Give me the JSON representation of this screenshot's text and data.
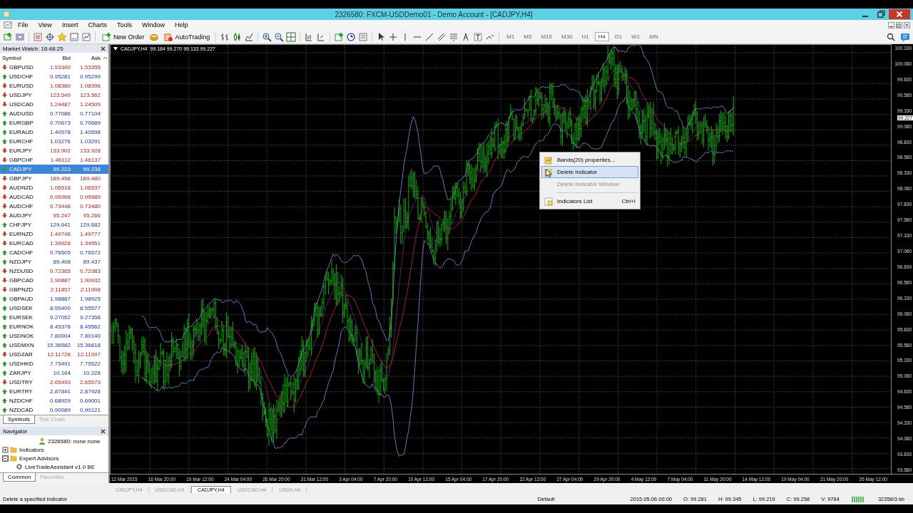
{
  "window": {
    "title": "2326580: FXCM-USDDemo01 - Demo Account - [CADJPY,H4]"
  },
  "menu": [
    "File",
    "View",
    "Insert",
    "Charts",
    "Tools",
    "Window",
    "Help"
  ],
  "toolbar": {
    "buttons": [
      {
        "label": "New Order"
      },
      {
        "label": "AutoTrading"
      }
    ],
    "timeframes": [
      {
        "label": "M1",
        "selected": false
      },
      {
        "label": "M5",
        "selected": false
      },
      {
        "label": "M15",
        "selected": false
      },
      {
        "label": "M30",
        "selected": false
      },
      {
        "label": "H1",
        "selected": false
      },
      {
        "label": "H4",
        "selected": true
      },
      {
        "label": "D1",
        "selected": false
      },
      {
        "label": "W1",
        "selected": false
      },
      {
        "label": "MN",
        "selected": false
      }
    ]
  },
  "market_watch": {
    "title": "Market Watch: 16:48:25",
    "columns": [
      "Symbol",
      "Bid",
      "Ask"
    ],
    "rows": [
      {
        "symbol": "GBPUSD",
        "bid": "1.53340",
        "ask": "1.53355",
        "kind": "down",
        "selected": false
      },
      {
        "symbol": "USDCHF",
        "bid": "0.95281",
        "ask": "0.95299",
        "kind": "up",
        "selected": false
      },
      {
        "symbol": "EURUSD",
        "bid": "1.08380",
        "ask": "1.08396",
        "kind": "down",
        "selected": false
      },
      {
        "symbol": "USDJPY",
        "bid": "123.549",
        "ask": "123.562",
        "kind": "down",
        "selected": false
      },
      {
        "symbol": "USDCAD",
        "bid": "1.24487",
        "ask": "1.24509",
        "kind": "down",
        "selected": false
      },
      {
        "symbol": "AUDUSD",
        "bid": "0.77086",
        "ask": "0.77104",
        "kind": "up",
        "selected": false
      },
      {
        "symbol": "EURGBP",
        "bid": "0.70673",
        "ask": "0.70689",
        "kind": "up",
        "selected": false
      },
      {
        "symbol": "EURAUD",
        "bid": "1.40578",
        "ask": "1.40598",
        "kind": "up",
        "selected": false
      },
      {
        "symbol": "EURCHF",
        "bid": "1.03276",
        "ask": "1.03291",
        "kind": "up",
        "selected": false
      },
      {
        "symbol": "EURJPY",
        "bid": "133.902",
        "ask": "133.928",
        "kind": "down",
        "selected": false
      },
      {
        "symbol": "GBPCHF",
        "bid": "1.46112",
        "ask": "1.46137",
        "kind": "down",
        "selected": false
      },
      {
        "symbol": "CADJPY",
        "bid": "99.223",
        "ask": "99.238",
        "kind": "up",
        "selected": true
      },
      {
        "symbol": "GBPJPY",
        "bid": "189.456",
        "ask": "189.480",
        "kind": "down",
        "selected": false
      },
      {
        "symbol": "AUDNZD",
        "bid": "1.06518",
        "ask": "1.06537",
        "kind": "down",
        "selected": false
      },
      {
        "symbol": "AUDCAD",
        "bid": "0.95968",
        "ask": "0.95989",
        "kind": "down",
        "selected": false
      },
      {
        "symbol": "AUDCHF",
        "bid": "0.73448",
        "ask": "0.73480",
        "kind": "down",
        "selected": false
      },
      {
        "symbol": "AUDJPY",
        "bid": "95.247",
        "ask": "95.266",
        "kind": "down",
        "selected": false
      },
      {
        "symbol": "CHFJPY",
        "bid": "129.641",
        "ask": "129.682",
        "kind": "up",
        "selected": false
      },
      {
        "symbol": "EURNZD",
        "bid": "1.49746",
        "ask": "1.49777",
        "kind": "down",
        "selected": false
      },
      {
        "symbol": "EURCAD",
        "bid": "1.34928",
        "ask": "1.34951",
        "kind": "down",
        "selected": false
      },
      {
        "symbol": "CADCHF",
        "bid": "0.76505",
        "ask": "0.76572",
        "kind": "up",
        "selected": false
      },
      {
        "symbol": "NZDJPY",
        "bid": "89.408",
        "ask": "89.437",
        "kind": "up",
        "selected": false
      },
      {
        "symbol": "NZDUSD",
        "bid": "0.72365",
        "ask": "0.72383",
        "kind": "down",
        "selected": false
      },
      {
        "symbol": "GBPCAD",
        "bid": "1.90887",
        "ask": "1.90932",
        "kind": "down",
        "selected": false
      },
      {
        "symbol": "GBPNZD",
        "bid": "2.11857",
        "ask": "2.11908",
        "kind": "down",
        "selected": false
      },
      {
        "symbol": "GBPAUD",
        "bid": "1.98887",
        "ask": "1.98925",
        "kind": "up",
        "selected": false
      },
      {
        "symbol": "USDSEK",
        "bid": "8.55400",
        "ask": "8.55577",
        "kind": "up",
        "selected": false
      },
      {
        "symbol": "EURSEK",
        "bid": "9.27052",
        "ask": "9.27358",
        "kind": "up",
        "selected": false
      },
      {
        "symbol": "EURNOK",
        "bid": "8.45378",
        "ask": "8.45562",
        "kind": "up",
        "selected": false
      },
      {
        "symbol": "USDNOK",
        "bid": "7.80004",
        "ask": "7.80140",
        "kind": "up",
        "selected": false
      },
      {
        "symbol": "USDMXN",
        "bid": "15.36582",
        "ask": "15.36818",
        "kind": "up",
        "selected": false
      },
      {
        "symbol": "USDZAR",
        "bid": "12.11728",
        "ask": "12.11997",
        "kind": "down",
        "selected": false
      },
      {
        "symbol": "USDHKD",
        "bid": "7.75491",
        "ask": "7.75522",
        "kind": "up",
        "selected": false
      },
      {
        "symbol": "ZARJPY",
        "bid": "10.164",
        "ask": "10.228",
        "kind": "up",
        "selected": false
      },
      {
        "symbol": "USDTRY",
        "bid": "2.65493",
        "ask": "2.65573",
        "kind": "down",
        "selected": false
      },
      {
        "symbol": "EURTRY",
        "bid": "2.87841",
        "ask": "2.87928",
        "kind": "up",
        "selected": false
      },
      {
        "symbol": "NZDCHF",
        "bid": "0.68929",
        "ask": "0.69001",
        "kind": "up",
        "selected": false
      },
      {
        "symbol": "NZDCAD",
        "bid": "0.90089",
        "ask": "0.90121",
        "kind": "up",
        "selected": false
      }
    ],
    "tabs": [
      {
        "label": "Symbols",
        "selected": true
      },
      {
        "label": "Tick Chart",
        "selected": false
      }
    ]
  },
  "navigator": {
    "title": "Navigator",
    "items": [
      {
        "label": "2326580: none none",
        "kind": "account"
      },
      {
        "label": "Indicators",
        "kind": "folder",
        "expanded": false
      },
      {
        "label": "Expert Advisors",
        "kind": "folder",
        "expanded": true,
        "children": [
          {
            "label": "LiveTradeAssistant v1.0 BE",
            "kind": "expert"
          }
        ]
      }
    ],
    "tabs": [
      {
        "label": "Common",
        "selected": true
      },
      {
        "label": "Favorites",
        "selected": false
      }
    ]
  },
  "chart": {
    "header": "CADJPY,H4  99.184 99.270 99.133 99.227",
    "current_price": "99.227",
    "price_labels": [
      "100.330",
      "100.080",
      "99.830",
      "99.580",
      "99.330",
      "99.080",
      "98.830",
      "98.580",
      "98.330",
      "98.080",
      "97.830",
      "97.580",
      "97.330",
      "97.080",
      "96.830",
      "96.580",
      "96.330",
      "96.080",
      "95.830",
      "95.580",
      "95.330",
      "95.080",
      "94.830",
      "94.580",
      "94.330",
      "94.080",
      "93.830",
      "93.580"
    ],
    "time_labels": [
      "12 Mar 2015",
      "16 Mar 20:00",
      "19 Mar 12:00",
      "24 Mar 04:00",
      "26 Mar 20:00",
      "31 Mar 12:00",
      "3 Apr 04:00",
      "7 Apr 20:00",
      "10 Apr 12:00",
      "15 Apr 04:00",
      "17 Apr 20:00",
      "22 Apr 12:00",
      "27 Apr 04:00",
      "29 Apr 20:00",
      "4 May 12:00",
      "7 May 04:00",
      "11 May 20:00",
      "14 May 12:00",
      "19 May 04:00",
      "21 May 20:00",
      "26 May 12:00"
    ]
  },
  "context_menu": [
    {
      "label": "Bands(20) properties...",
      "selected": false,
      "disabled": false
    },
    {
      "label": "Delete Indicator",
      "selected": true,
      "disabled": false
    },
    {
      "label": "Delete Indicator Window",
      "selected": false,
      "disabled": true
    },
    {
      "label": "Indicators List",
      "shortcut": "Ctrl+I",
      "selected": false,
      "disabled": false
    }
  ],
  "chart_tabs": [
    {
      "label": "CADJPY,H4",
      "selected": false
    },
    {
      "label": "USDCAD,H4",
      "selected": false
    },
    {
      "label": "CADJPY,H4",
      "selected": true
    },
    {
      "label": "USDCAD,H4",
      "selected": false
    },
    {
      "label": "USDX,H4",
      "selected": false
    }
  ],
  "status_bar": {
    "hint": "Delete a specified indicator",
    "profile": "Default",
    "time": "2015.05.06 00:00",
    "open": "O: 99.281",
    "high": "H: 99.345",
    "low": "L: 99.219",
    "close": "C: 99.258",
    "volume": "V: 9784",
    "traffic": "32358/3 kb"
  }
}
